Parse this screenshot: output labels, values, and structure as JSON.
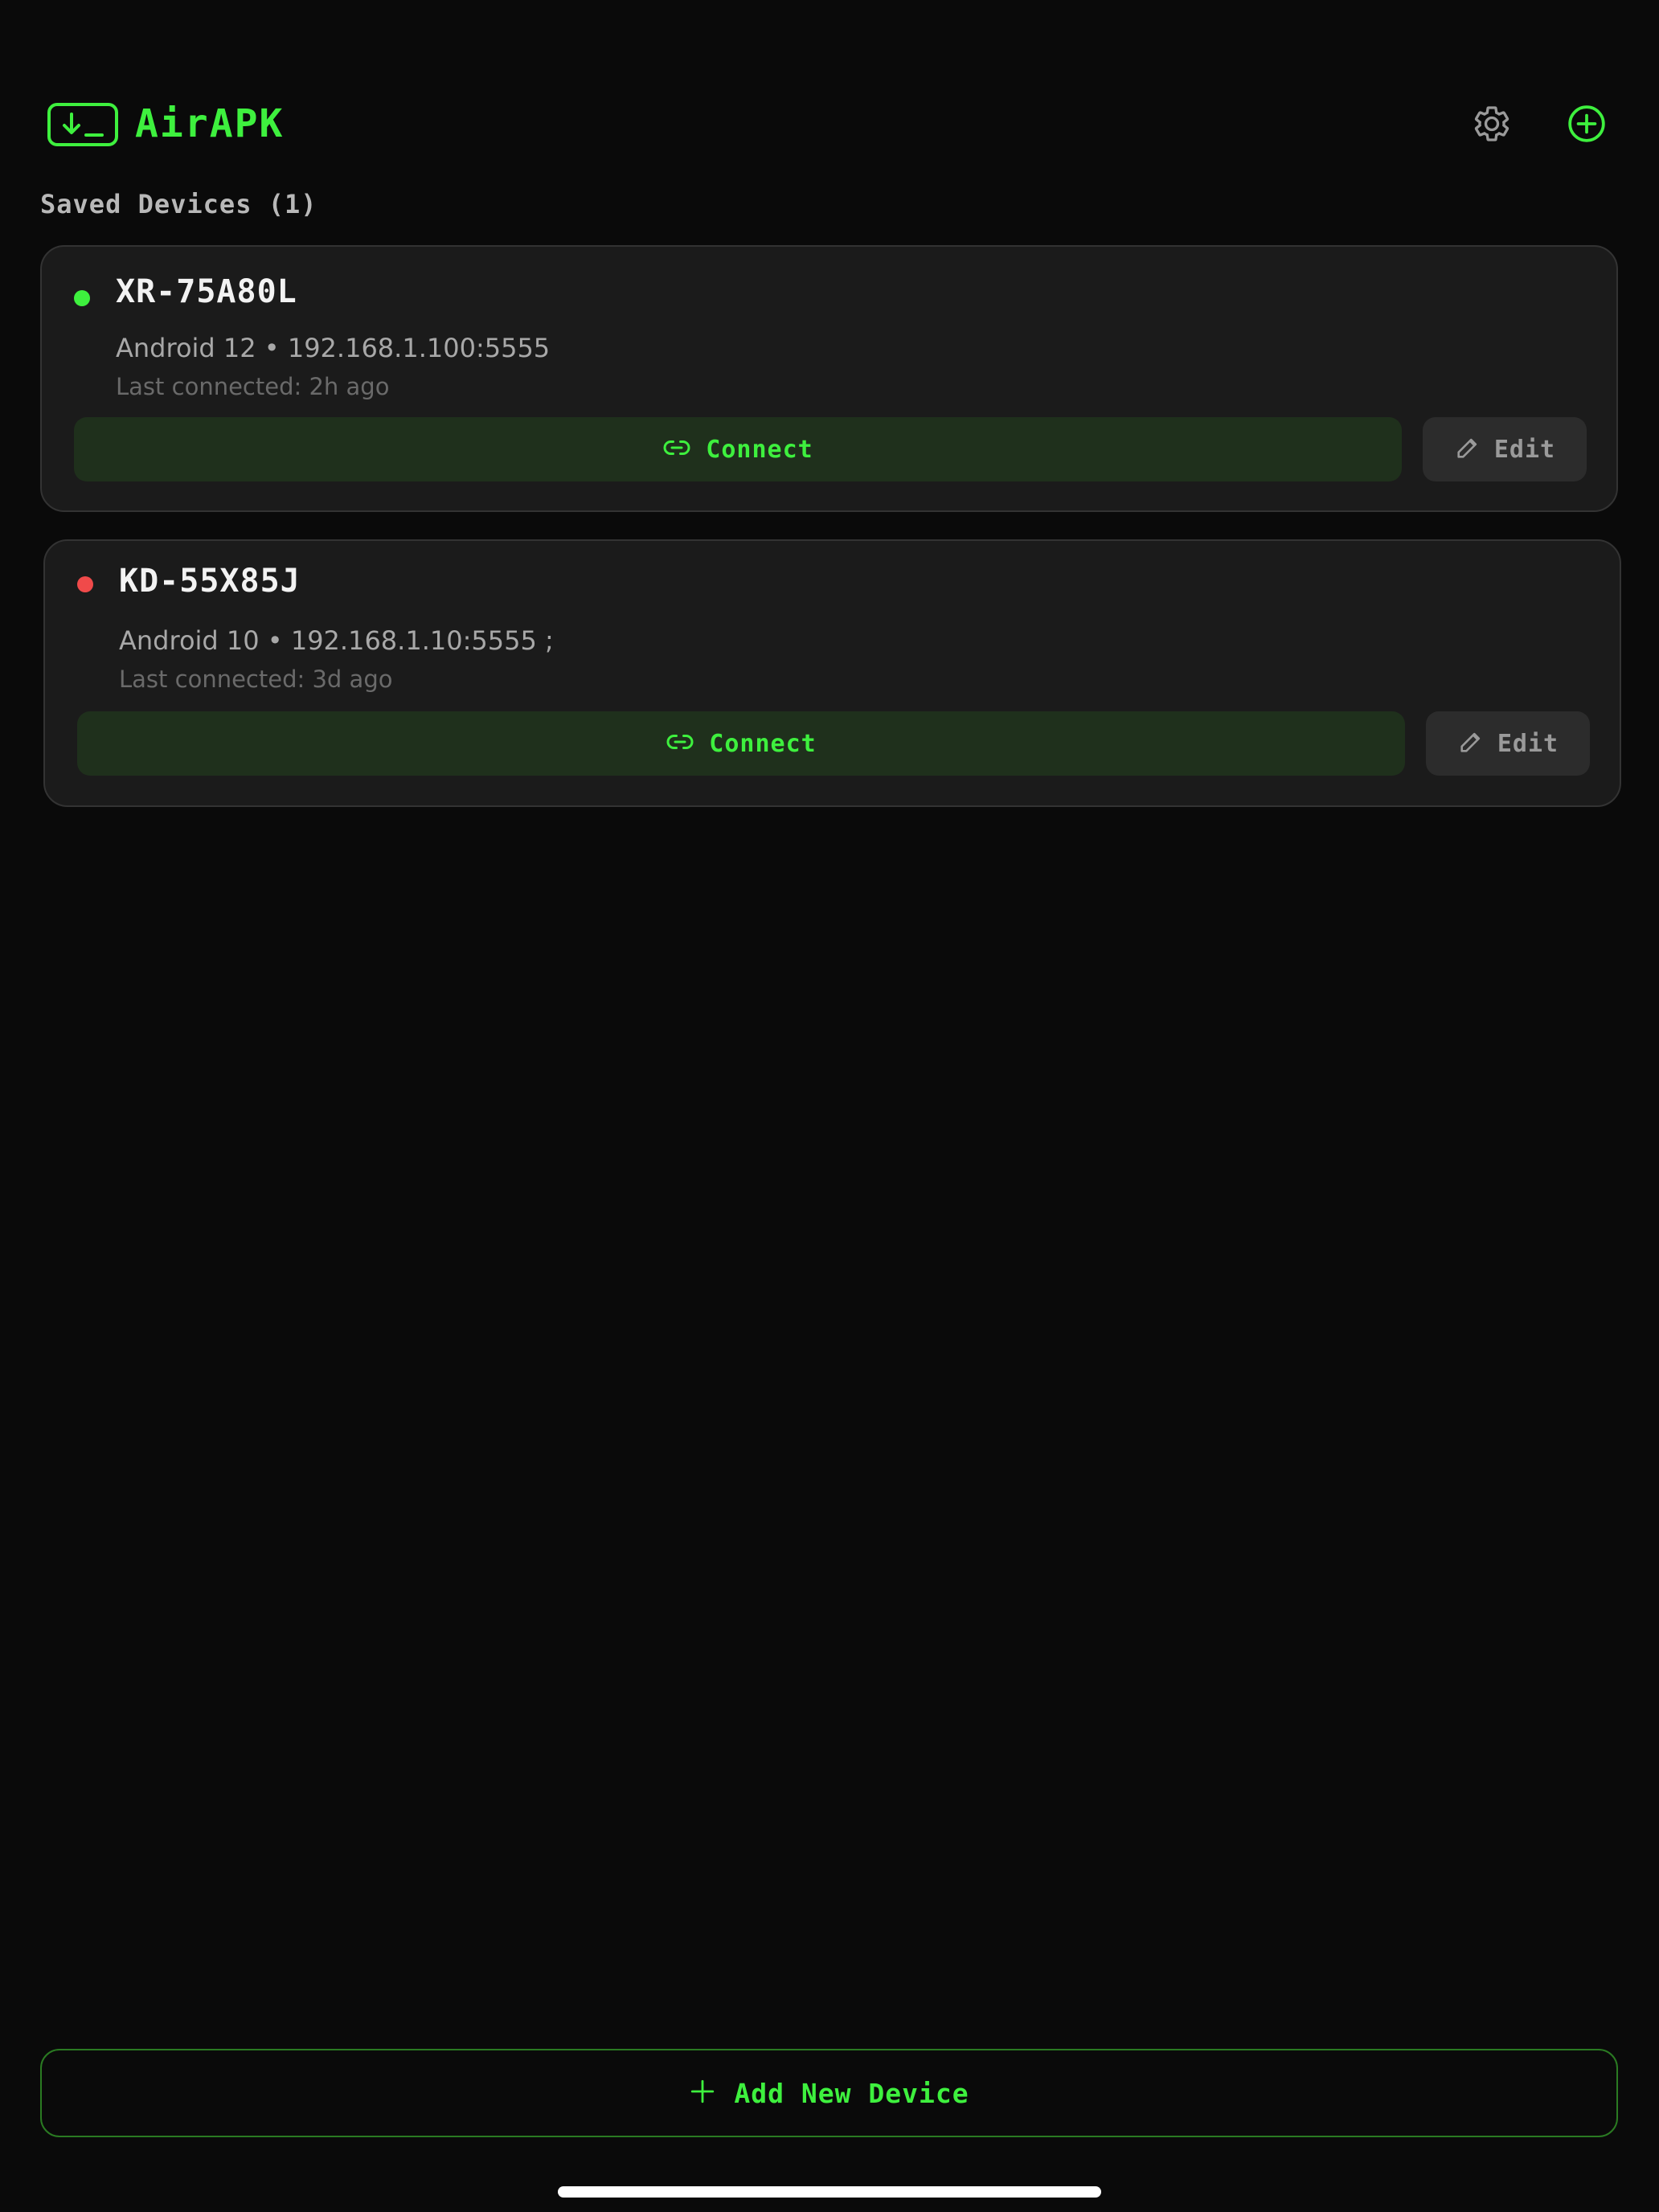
{
  "app": {
    "title": "AirAPK",
    "logo_icon": "terminal-download-icon"
  },
  "header": {
    "settings_icon": "gear-icon",
    "add_icon": "plus-circle-icon"
  },
  "section": {
    "label": "Saved Devices (1)"
  },
  "devices": [
    {
      "name": "XR-75A80L",
      "status": "online",
      "status_color": "#3ef03e",
      "info": "Android 12 • 192.168.1.100:5555",
      "last_connected": "Last connected: 2h ago",
      "connect_label": "Connect",
      "edit_label": "Edit"
    },
    {
      "name": "KD-55X85J",
      "status": "offline",
      "status_color": "#f04a4a",
      "info": "Android 10 • 192.168.1.10:5555 ;",
      "last_connected": "Last connected: 3d ago",
      "connect_label": "Connect",
      "edit_label": "Edit"
    }
  ],
  "footer": {
    "add_device_label": "Add New Device"
  },
  "colors": {
    "accent": "#3ef03e",
    "background": "#0a0a0a",
    "card": "#1b1b1b",
    "offline": "#f04a4a"
  }
}
